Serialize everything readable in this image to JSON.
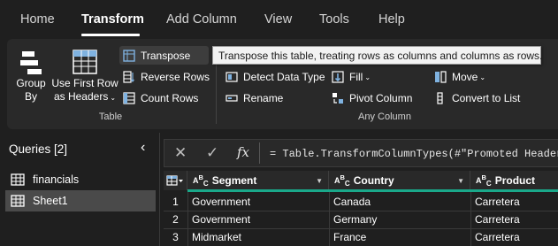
{
  "tabs": [
    "Home",
    "Transform",
    "Add Column",
    "View",
    "Tools",
    "Help"
  ],
  "ribbon": {
    "group_by": [
      "Group",
      "By"
    ],
    "use_first_row": [
      "Use First Row",
      "as Headers"
    ],
    "transpose": "Transpose",
    "reverse_rows": "Reverse Rows",
    "count_rows": "Count Rows",
    "table_group": "Table",
    "detect_data_type": "Detect Data Type",
    "fill": "Fill",
    "move": "Move",
    "rename": "Rename",
    "pivot_column": "Pivot Column",
    "convert_to_list": "Convert to List",
    "any_column_group": "Any Column"
  },
  "tooltip": "Transpose this table, treating rows as columns and columns as rows.",
  "queries": {
    "header": "Queries [2]",
    "items": [
      "financials",
      "Sheet1"
    ],
    "selected": "Sheet1"
  },
  "formula_bar": {
    "fx": "fx",
    "formula": "= Table.TransformColumnTypes(#\"Promoted Headers\","
  },
  "table": {
    "columns": [
      "Segment",
      "Country",
      "Product"
    ],
    "rows": [
      {
        "n": "1",
        "cells": [
          "Government",
          "Canada",
          "Carretera"
        ]
      },
      {
        "n": "2",
        "cells": [
          "Government",
          "Germany",
          "Carretera"
        ]
      },
      {
        "n": "3",
        "cells": [
          "Midmarket",
          "France",
          "Carretera"
        ]
      }
    ]
  },
  "colors": {
    "background": "#1f1f1f",
    "ribbon": "#292929",
    "accent_teal": "#1aa88a",
    "selected_query": "#4a4a4a"
  }
}
